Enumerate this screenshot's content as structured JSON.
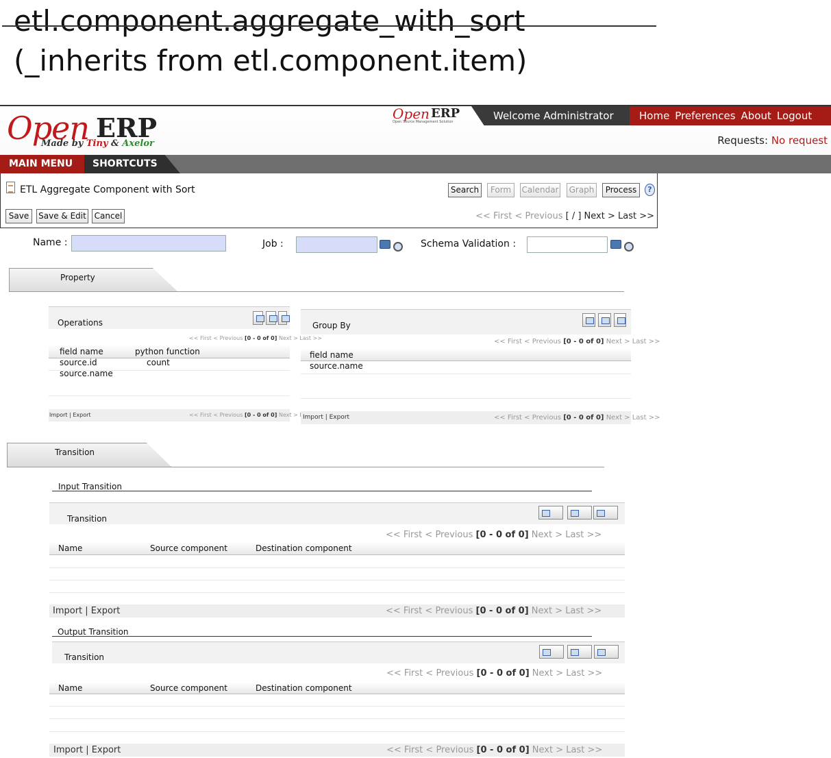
{
  "heading": {
    "line1": "etl.component.aggregate_with_sort",
    "line2": "(_inherits from etl.component.item)"
  },
  "logo": {
    "open": "Open",
    "erp": "ERP",
    "made_by": "Made by ",
    "tiny": "Tiny",
    "amp": " & ",
    "axelor": "Axelor",
    "small_open": "Open",
    "small_erp": "ERP",
    "small_tag": "Open Source Management Solution"
  },
  "header": {
    "welcome": "Welcome Administrator",
    "nav": [
      "Home",
      "Preferences",
      "About",
      "Logout"
    ],
    "requests_label": "Requests:",
    "requests_value": "No request"
  },
  "menu": {
    "main_menu": "MAIN MENU",
    "shortcuts": "SHORTCUTS"
  },
  "form": {
    "title": "ETL Aggregate Component with Sort",
    "view_buttons": [
      "Search",
      "Form",
      "Calendar",
      "Graph",
      "Process"
    ],
    "help": "?",
    "action_buttons": [
      "Save",
      "Save & Edit",
      "Cancel"
    ],
    "pager": {
      "first": "<< First",
      "previous": "< Previous",
      "pos": "[ / ]",
      "next": "Next >",
      "last": "Last >>"
    },
    "fields": {
      "name_label": "Name :",
      "job_label": "Job :",
      "schema_label": "Schema Validation  :"
    }
  },
  "tabs": {
    "property": "Property",
    "transition": "Transition"
  },
  "operations": {
    "title": "Operations",
    "pager": {
      "first": "<< First",
      "previous": "< Previous",
      "pos": "[0 - 0 of 0]",
      "next": "Next >",
      "last": "Last >>"
    },
    "columns": [
      "field name",
      "python  function"
    ],
    "rows": [
      {
        "field": "source.id",
        "func": "count"
      },
      {
        "field": "source.name",
        "func": ""
      }
    ],
    "footer_left": "Import | Export"
  },
  "groupby": {
    "title": "Group By",
    "pager": {
      "first": "<< First",
      "previous": "< Previous",
      "pos": "[0 - 0 of 0]",
      "next": "Next >",
      "last": "Last >>"
    },
    "columns": [
      "field name"
    ],
    "rows": [
      {
        "field": "source.name"
      }
    ],
    "footer_left": "Import | Export"
  },
  "input_transition": {
    "section": "Input Transition",
    "title": "Transition",
    "pager": {
      "first": "<< First",
      "previous": "< Previous",
      "pos": "[0 - 0 of 0]",
      "next": "Next >",
      "last": "Last >>"
    },
    "columns": [
      "Name",
      "Source component",
      "Destination component"
    ],
    "footer_left": "Import | Export"
  },
  "output_transition": {
    "section": "Output Transition",
    "title": "Transition",
    "pager": {
      "first": "<< First",
      "previous": "< Previous",
      "pos": "[0 - 0 of 0]",
      "next": "Next >",
      "last": "Last >>"
    },
    "columns": [
      "Name",
      "Source component",
      "Destination component"
    ],
    "footer_left": "Import | Export"
  }
}
